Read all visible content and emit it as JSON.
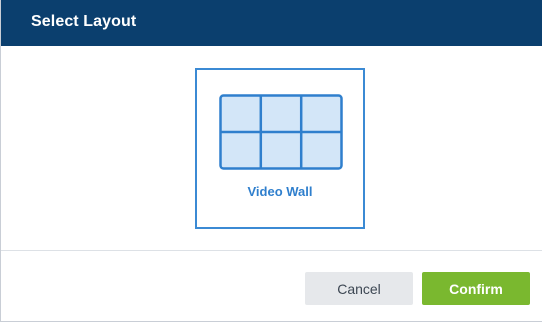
{
  "dialog": {
    "title": "Select Layout"
  },
  "layouts": [
    {
      "label": "Video Wall",
      "icon": "video-wall-grid-icon",
      "selected": true
    }
  ],
  "buttons": {
    "cancel_label": "Cancel",
    "confirm_label": "Confirm"
  },
  "colors": {
    "header_bg": "#0b3f6e",
    "accent_blue": "#3b8ad4",
    "confirm_green": "#7ab82f",
    "cancel_gray": "#e6e8eb"
  }
}
